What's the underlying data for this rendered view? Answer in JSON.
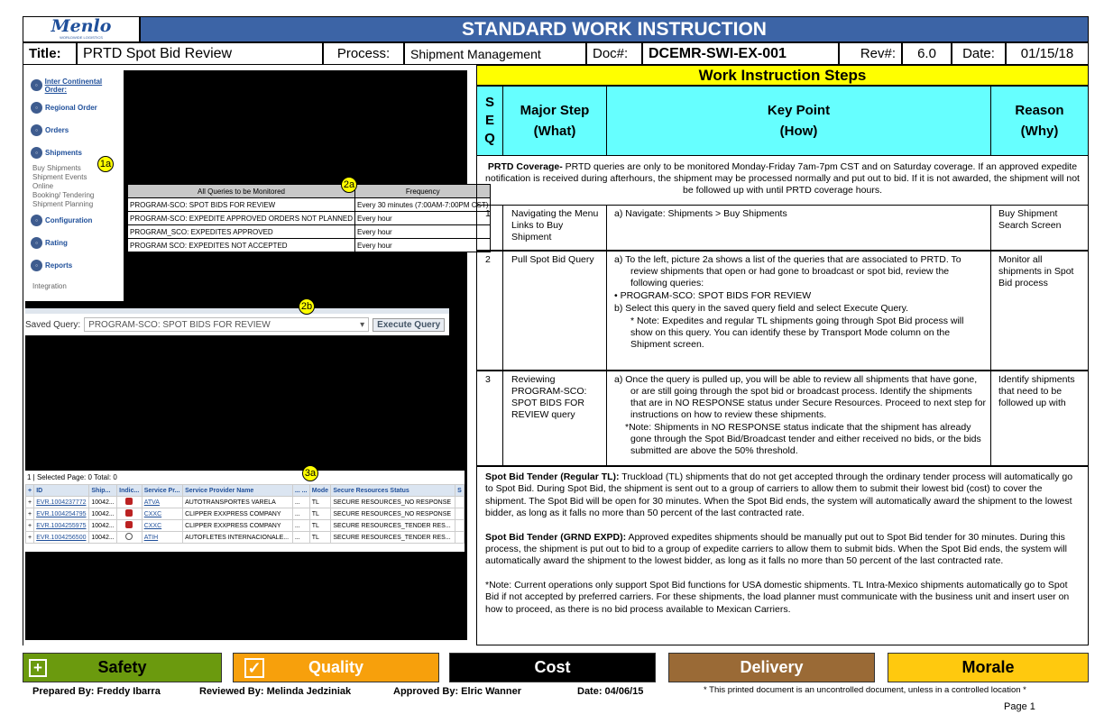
{
  "header": {
    "logo_text": "Menlo",
    "logo_subtext": "WORLDWIDE LOGISTICS",
    "doc_title": "STANDARD WORK INSTRUCTION",
    "title_label": "Title:",
    "title_value": "PRTD Spot Bid Review",
    "process_label": "Process:",
    "process_value": "Shipment Management",
    "doc_label": "Doc#:",
    "doc_value": "DCEMR-SWI-EX-001",
    "rev_label": "Rev#:",
    "rev_value": "6.0",
    "date_label": "Date:",
    "date_value": "01/15/18"
  },
  "screens": {
    "nav": {
      "items": [
        "Inter Continental Order:",
        "Regional Order",
        "Orders",
        "Shipments"
      ],
      "subitems": [
        "Buy Shipments",
        "Shipment Events",
        "Online",
        "Booking/ Tendering",
        "Shipment Planning"
      ],
      "items2": [
        "Configuration",
        "Rating",
        "Reports"
      ],
      "footer": "Integration"
    },
    "badges": {
      "b1a": "1a",
      "b2a": "2a",
      "b2b": "2b",
      "b3a": "3a"
    },
    "queries": {
      "headers": [
        "All Queries to be Monitored",
        "Frequency"
      ],
      "rows": [
        [
          "PROGRAM-SCO: SPOT BIDS FOR REVIEW",
          "Every 30 minutes (7:00AM-7:00PM CST)"
        ],
        [
          "PROGRAM-SCO: EXPEDITE APPROVED ORDERS NOT PLANNED",
          "Every hour"
        ],
        [
          "PROGRAM_SCO: EXPEDITES APPROVED",
          "Every hour"
        ],
        [
          "PROGRAM SCO: EXPEDITES NOT ACCEPTED",
          "Every hour"
        ]
      ]
    },
    "saved_query": {
      "label": "Saved Query:",
      "value": "PROGRAM-SCO: SPOT BIDS FOR REVIEW",
      "button": "Execute Query"
    },
    "results": {
      "toolbar": "1 | Selected Page: 0 Total: 0",
      "headers": [
        "+",
        "ID",
        "Ship...",
        "Indic...",
        "Service Pr...",
        "Service Provider Name",
        "... ...",
        "Mode",
        "Secure Resources Status",
        "S"
      ],
      "rows": [
        [
          "+",
          "EVR.1004237772",
          "10042...",
          "red",
          "ATVA",
          "AUTOTRANSPORTES VARELA",
          "...",
          "TL",
          "SECURE RESOURCES_NO RESPONSE"
        ],
        [
          "+",
          "EVR.1004254795",
          "10042...",
          "red",
          "CXXC",
          "CLIPPER EXXPRESS COMPANY",
          "...",
          "TL",
          "SECURE RESOURCES_NO RESPONSE"
        ],
        [
          "+",
          "EVR.1004255975",
          "10042...",
          "red",
          "CXXC",
          "CLIPPER EXXPRESS COMPANY",
          "...",
          "TL",
          "SECURE RESOURCES_TENDER RES..."
        ],
        [
          "+",
          "EVR.1004256500",
          "10042...",
          "none",
          "ATIH",
          "AUTOFLETES INTERNACIONALE...",
          "...",
          "TL",
          "SECURE RESOURCES_TENDER RES..."
        ]
      ]
    }
  },
  "steps": {
    "section_title": "Work Instruction Steps",
    "headers": {
      "seq": [
        "S",
        "E",
        "Q"
      ],
      "major1": "Major Step",
      "major2": "(What)",
      "key1": "Key Point",
      "key2": "(How)",
      "reason1": "Reason",
      "reason2": "(Why)"
    },
    "coverage_label": "PRTD Coverage-",
    "coverage_text": " PRTD queries are only to be monitored Monday-Friday 7am-7pm CST and on Saturday coverage. If an approved expedite notification is received during afterhours, the shipment may be processed normally and put out to bid. If it is not awarded, the shipment will not be followed up with until PRTD coverage hours.",
    "rows": [
      {
        "seq": "1",
        "major": "Navigating the Menu Links to Buy Shipment",
        "key": [
          "a)  Navigate: Shipments > Buy Shipments"
        ],
        "reason": "Buy Shipment Search Screen"
      },
      {
        "seq": "2",
        "major": "Pull Spot Bid Query",
        "key": [
          "a)  To the left,  picture 2a shows a list of the queries that are associated to PRTD. To review shipments that  open or had gone to broadcast or spot bid, review the following queries:",
          "•   PROGRAM-SCO: SPOT BIDS FOR REVIEW",
          "b)   Select this query in the saved query field and select Execute Query.",
          "* Note: Expedites and regular TL shipments going through Spot Bid process will show on this query. You can identify these by Transport Mode column on the Shipment screen."
        ],
        "reason": "Monitor all shipments in Spot Bid process"
      },
      {
        "seq": "3",
        "major": "Reviewing PROGRAM-SCO: SPOT BIDS FOR REVIEW query",
        "key": [
          "a)  Once the query is pulled up, you will be able to review all shipments that have gone, or are still going through the spot bid or broadcast process. Identify the shipments that are in NO RESPONSE status under Secure Resources. Proceed to next step for instructions on how to review these shipments.",
          "*Note: Shipments in NO RESPONSE status indicate that the shipment has already gone through the Spot Bid/Broadcast tender and either received no bids, or the bids submitted are above the 50% threshold."
        ],
        "reason": "Identify shipments that need to be followed up with"
      }
    ],
    "notes": [
      {
        "label": "Spot Bid Tender (Regular TL):",
        "text": " Truckload (TL) shipments that do not get accepted through the ordinary tender process will automatically go to Spot Bid. During Spot Bid, the shipment is sent out to a group of carriers to allow them to submit their lowest bid (cost) to cover the shipment. The Spot Bid will be open for 30 minutes. When the Spot Bid ends, the system will automatically award the shipment to the lowest bidder, as long as it falls no more than 50 percent of the last contracted rate."
      },
      {
        "label": "Spot Bid Tender (GRND EXPD):",
        "text": " Approved expedites shipments should be manually put out to Spot Bid tender for 30 minutes. During this process, the shipment is put out to bid to a group of expedite carriers to allow them to submit bids. When the Spot Bid ends, the system will automatically award the shipment to the lowest bidder, as long as it falls no more than 50 percent of the last contracted rate."
      },
      {
        "label": "",
        "text": "*Note: Current operations only support Spot Bid functions for USA domestic shipments. TL Intra-Mexico shipments automatically go to Spot Bid if not accepted by preferred carriers. For these shipments, the load planner must communicate with the business unit and insert user on how to proceed, as there is no bid process available to Mexican Carriers."
      }
    ]
  },
  "footer": {
    "categories": [
      {
        "label": "Safety",
        "color": "#6b9a0e"
      },
      {
        "label": "Quality",
        "color": "#f7a00c"
      },
      {
        "label": "Cost",
        "color": "#000000"
      },
      {
        "label": "Delivery",
        "color": "#9a6a36"
      },
      {
        "label": "Morale",
        "color": "#ffc90e"
      }
    ],
    "prepared": "Prepared By: Freddy Ibarra",
    "reviewed": "Reviewed By: Melinda Jedziniak",
    "approved": "Approved By: Elric Wanner",
    "date": "Date: 04/06/15",
    "disclaimer": "* This printed document is an uncontrolled document, unless in a controlled location *",
    "page": "Page 1"
  }
}
